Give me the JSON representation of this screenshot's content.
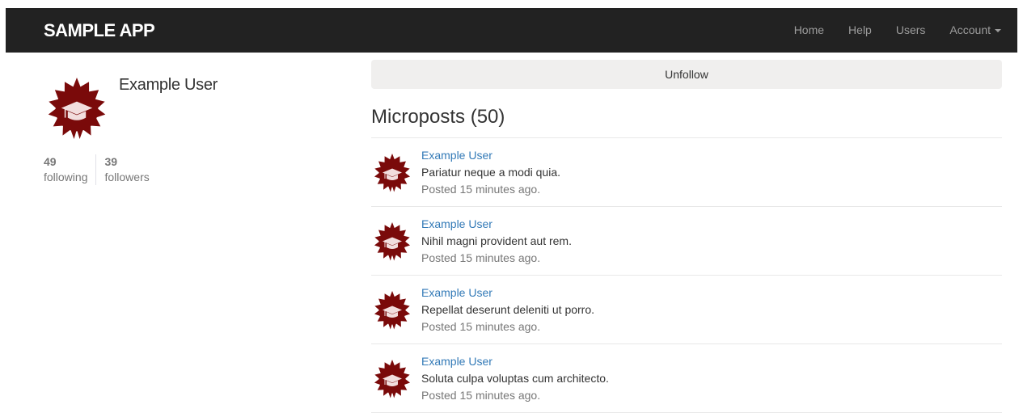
{
  "navbar": {
    "brand": "sample app",
    "items": [
      {
        "label": "Home"
      },
      {
        "label": "Help"
      },
      {
        "label": "Users"
      },
      {
        "label": "Account"
      }
    ]
  },
  "colors": {
    "navbar_bg": "#222222",
    "link": "#337ab7",
    "avatar": "#7a0a0a"
  },
  "profile": {
    "name": "Example User",
    "avatar_icon": "graduation-cap-badge-icon",
    "following_count": "49",
    "following_label": "following",
    "followers_count": "39",
    "followers_label": "followers"
  },
  "main": {
    "unfollow_label": "Unfollow",
    "heading": "Microposts (50)",
    "posts": [
      {
        "user": "Example User",
        "content": "Pariatur neque a modi quia.",
        "time": "Posted 15 minutes ago."
      },
      {
        "user": "Example User",
        "content": "Nihil magni provident aut rem.",
        "time": "Posted 15 minutes ago."
      },
      {
        "user": "Example User",
        "content": "Repellat deserunt deleniti ut porro.",
        "time": "Posted 15 minutes ago."
      },
      {
        "user": "Example User",
        "content": "Soluta culpa voluptas cum architecto.",
        "time": "Posted 15 minutes ago."
      }
    ]
  }
}
